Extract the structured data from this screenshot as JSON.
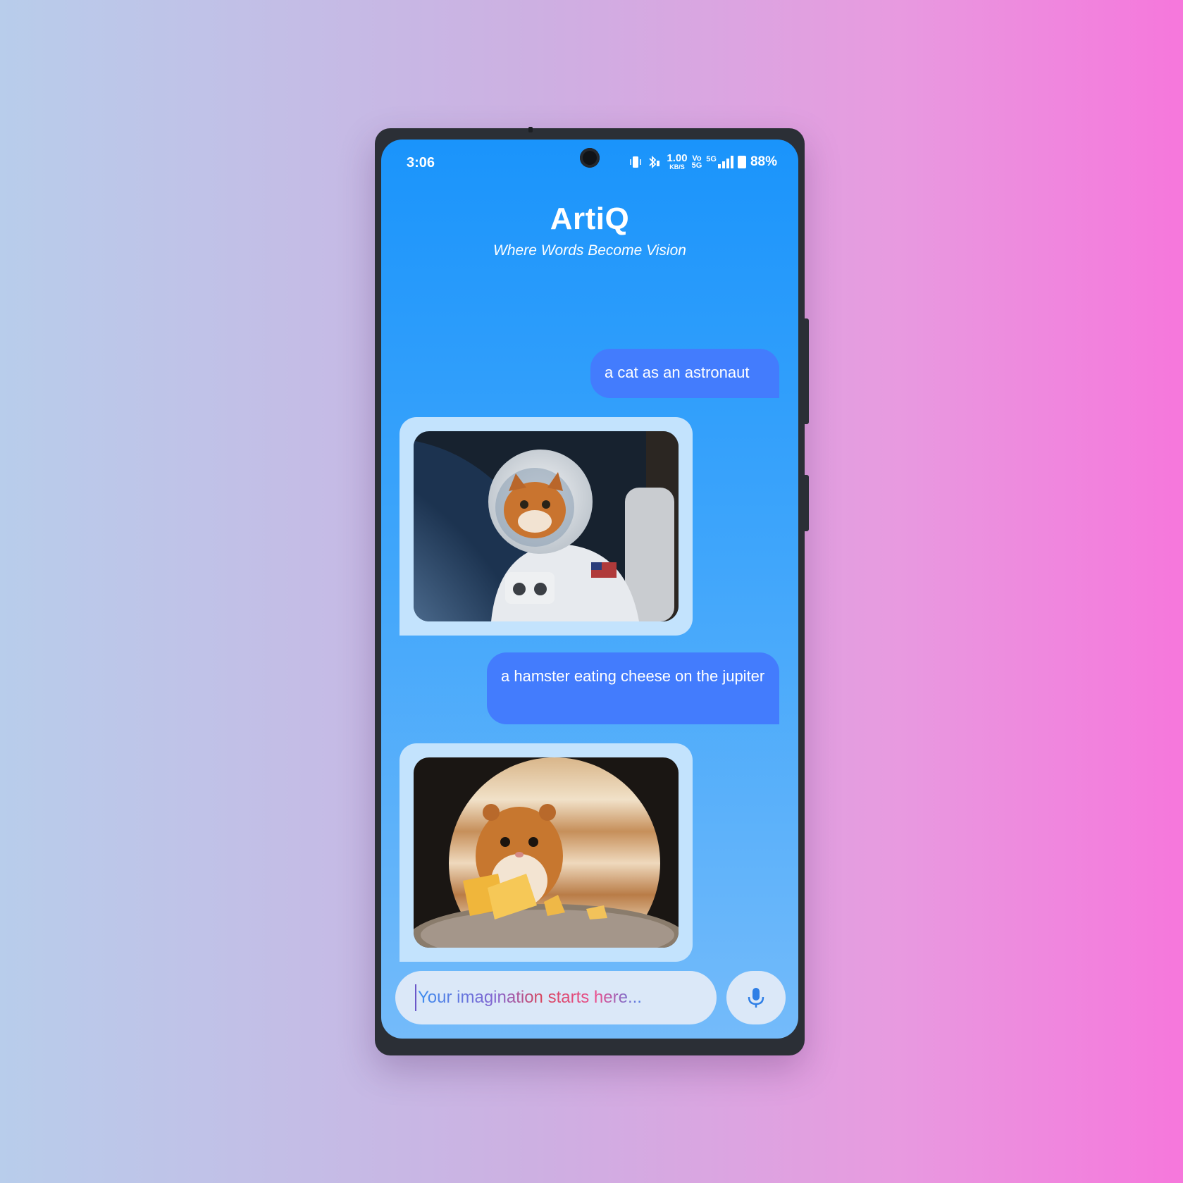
{
  "status_bar": {
    "time": "3:06",
    "data_speed_value": "1.00",
    "data_speed_unit": "KB/S",
    "volte_top": "Vo",
    "volte_bottom": "5G",
    "network": "5G",
    "battery": "88%"
  },
  "header": {
    "title": "ArtiQ",
    "subtitle": "Where Words Become Vision"
  },
  "messages": [
    {
      "type": "prompt",
      "text": "a cat as an astronaut"
    },
    {
      "type": "image",
      "subject": "cat-astronaut-image"
    },
    {
      "type": "prompt",
      "text": "a hamster eating cheese on the jupiter"
    },
    {
      "type": "image",
      "subject": "hamster-jupiter-image"
    }
  ],
  "input": {
    "placeholder": "Your imagination starts here..."
  },
  "icons": {
    "mic": "mic-icon"
  },
  "colors": {
    "bubble": "#437cfd",
    "image_card": "#c3e3fd",
    "screen_top": "#1a94fb",
    "screen_bottom": "#74bbfa"
  }
}
